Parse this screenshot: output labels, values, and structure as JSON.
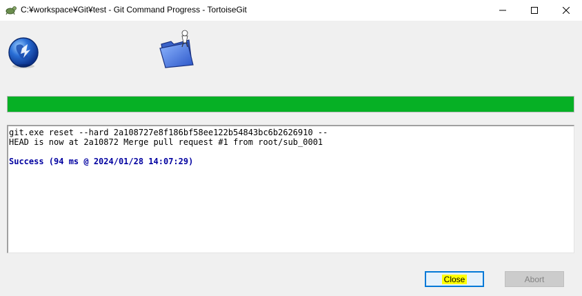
{
  "window": {
    "title": "C:¥workspace¥Git¥test - Git Command Progress - TortoiseGit",
    "controls": {
      "minimize": "minimize-icon",
      "maximize": "maximize-icon",
      "close": "close-icon"
    }
  },
  "icons": {
    "app": "tortoisegit-icon",
    "globe": "globe-icon",
    "folder": "folder-icon"
  },
  "progress": {
    "value": 1.0,
    "color": "#06b025"
  },
  "output": {
    "lines": [
      "git.exe reset --hard 2a108727e8f186bf58ee122b54843bc6b2626910 --",
      "HEAD is now at 2a10872 Merge pull request #1 from root/sub_0001",
      "",
      "Success (94 ms @ 2024/01/28 14:07:29)"
    ],
    "success_color": "#0000a0"
  },
  "buttons": {
    "close_label": "Close",
    "abort_label": "Abort"
  }
}
